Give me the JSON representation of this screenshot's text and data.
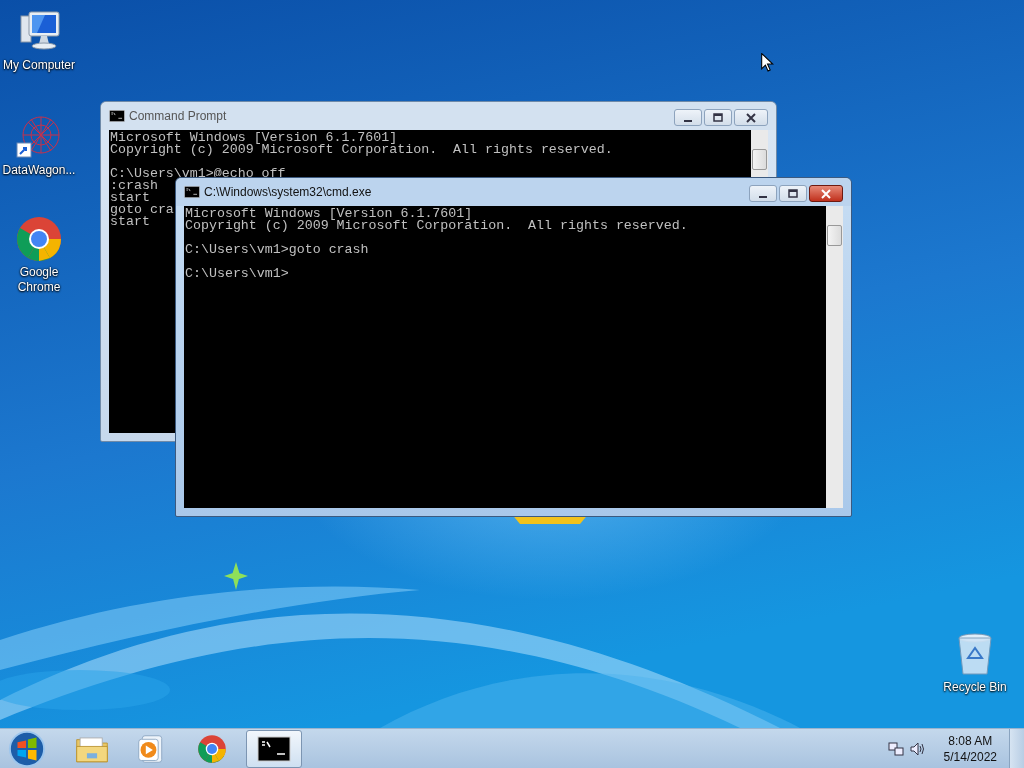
{
  "desktop_icons": [
    {
      "kind": "computer",
      "label": "My Computer"
    },
    {
      "kind": "app",
      "label": "DataWagon..."
    },
    {
      "kind": "chrome",
      "label": "Google Chrome"
    },
    {
      "kind": "recycle",
      "label": "Recycle Bin"
    }
  ],
  "windows": [
    {
      "title": "Command Prompt",
      "active": false,
      "blocks": [
        [
          "Microsoft Windows [Version 6.1.7601]",
          "Copyright (c) 2009 Microsoft Corporation.  All rights reserved."
        ],
        [
          "C:\\Users\\vm1>@echo off",
          ":crash",
          "start",
          "goto cra",
          "start"
        ]
      ]
    },
    {
      "title": "C:\\Windows\\system32\\cmd.exe",
      "active": true,
      "blocks": [
        [
          "Microsoft Windows [Version 6.1.7601]",
          "Copyright (c) 2009 Microsoft Corporation.  All rights reserved."
        ],
        [
          "C:\\Users\\vm1>goto crash"
        ],
        [
          "C:\\Users\\vm1>"
        ]
      ]
    }
  ],
  "taskbar": {
    "buttons": [
      {
        "kind": "start",
        "selected": false
      },
      {
        "kind": "folder",
        "selected": false
      },
      {
        "kind": "media",
        "selected": false
      },
      {
        "kind": "chrome",
        "selected": false
      },
      {
        "kind": "console",
        "selected": true
      }
    ],
    "time": "8:08 AM",
    "date": "5/14/2022"
  }
}
